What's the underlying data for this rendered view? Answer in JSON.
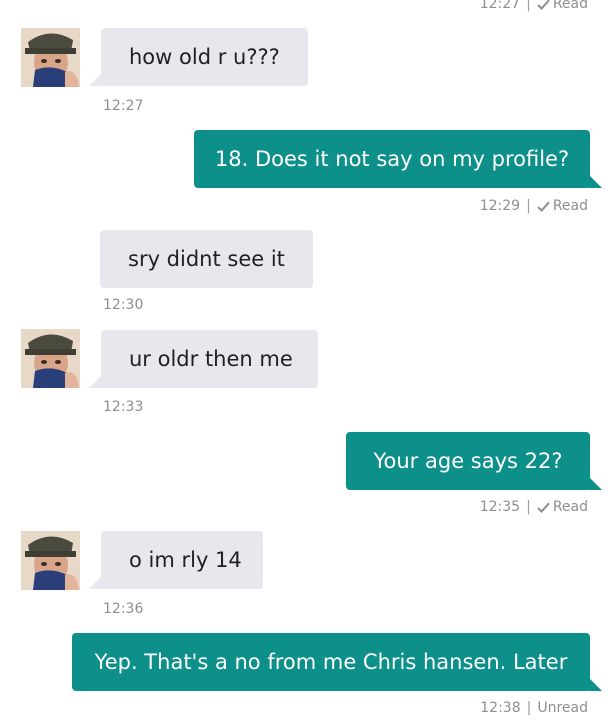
{
  "messages": [
    {
      "id": "m0",
      "meta_time": "12:27",
      "meta_status": "Read"
    },
    {
      "id": "m1",
      "text": "how old r u???",
      "time": "12:27"
    },
    {
      "id": "m2",
      "text": "18. Does it not say on my profile?",
      "time": "12:29",
      "status": "Read"
    },
    {
      "id": "m3",
      "text": "sry didnt see it",
      "time": "12:30"
    },
    {
      "id": "m4",
      "text": "ur oldr then me",
      "time": "12:33"
    },
    {
      "id": "m5",
      "text": "Your age says 22?",
      "time": "12:35",
      "status": "Read"
    },
    {
      "id": "m6",
      "text": "o im rly 14",
      "time": "12:36"
    },
    {
      "id": "m7",
      "text": "Yep. That's a no from me Chris hansen. Later",
      "time": "12:38",
      "status": "Unread"
    }
  ],
  "separator": "|",
  "icons": {
    "read_check": "check-icon",
    "avatar": "avatar-photo"
  },
  "colors": {
    "incoming_bubble": "#e6e8ee",
    "outgoing_bubble": "#0d8f8a",
    "meta_text": "#8e8e93"
  }
}
